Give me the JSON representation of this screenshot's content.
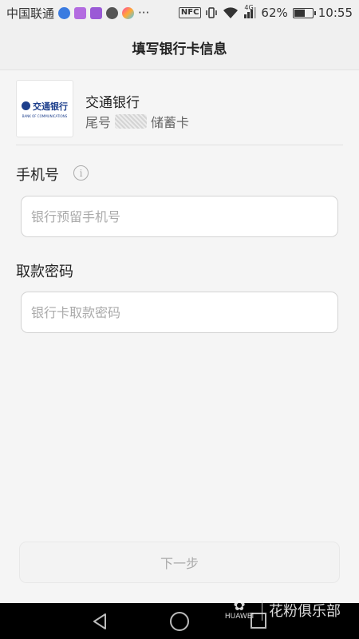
{
  "status_bar": {
    "carrier": "中国联通",
    "more": "···",
    "nfc": "NFC",
    "network": "4G",
    "battery_percent": "62%",
    "battery_level": 0.62,
    "time": "10:55"
  },
  "header": {
    "title": "填写银行卡信息"
  },
  "bank_card": {
    "logo_cn": "交通银行",
    "logo_en": "BANK OF COMMUNICATIONS",
    "name": "交通银行",
    "tail_prefix": "尾号",
    "card_type": "储蓄卡"
  },
  "form": {
    "phone_label": "手机号",
    "phone_placeholder": "银行预留手机号",
    "phone_value": "",
    "password_label": "取款密码",
    "password_placeholder": "银行卡取款密码",
    "password_value": ""
  },
  "actions": {
    "next_label": "下一步"
  },
  "watermark": {
    "brand": "HUAWEI",
    "club": "花粉俱乐部"
  },
  "colors": {
    "bank_blue": "#1d3f8c",
    "placeholder_gray": "#aaaaaa",
    "disabled_text": "#aaaaaa"
  }
}
